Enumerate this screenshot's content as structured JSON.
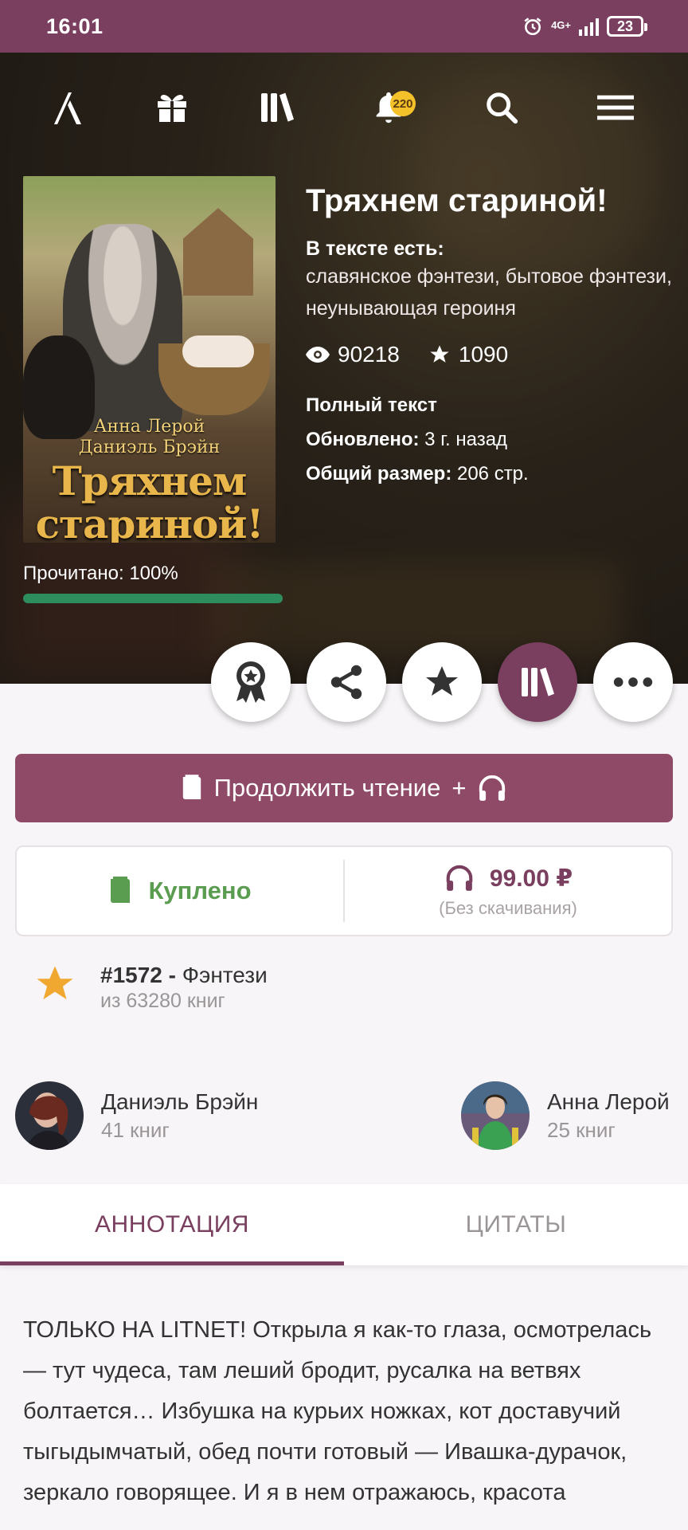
{
  "status_bar": {
    "time": "16:01",
    "network": "4G+",
    "battery": "23"
  },
  "nav": {
    "notifications_count": "220"
  },
  "book": {
    "title": "Тряхнем стариной!",
    "tags_heading": "В тексте есть:",
    "tags": "славянское фэнтези, бытовое фэнтези, неунывающая героиня",
    "views": "90218",
    "stars": "1090",
    "status": "Полный текст",
    "updated_label": "Обновлено:",
    "updated_value": " 3 г. назад",
    "size_label": "Общий размер:",
    "size_value": " 206 стр.",
    "cover_authors_line1": "Анна Лерой",
    "cover_authors_line2": "Даниэль Брэйн",
    "cover_title_line1": "Тряхнем",
    "cover_title_line2": "стариной!"
  },
  "progress": {
    "label": "Прочитано: 100%",
    "value": 1.0
  },
  "continue_button": {
    "label": "Продолжить чтение",
    "plus": "+"
  },
  "purchase": {
    "bought_label": "Куплено",
    "price": "99.00 ₽",
    "price_note": "(Без скачивания)"
  },
  "rating": {
    "rank": "#1572 -",
    "genre": " Фэнтези",
    "total": "из 63280 книг"
  },
  "authors": [
    {
      "name": "Даниэль Брэйн",
      "books": "41 книг"
    },
    {
      "name": "Анна Лерой",
      "books": "25 книг"
    }
  ],
  "tabs": [
    {
      "label": "АННОТАЦИЯ",
      "active": true
    },
    {
      "label": "ЦИТАТЫ",
      "active": false
    }
  ],
  "annotation": "ТОЛЬКО НА LITNET! Открыла я как-то глаза, осмотрелась — тут чудеса, там леший бродит, русалка на ветвях болтается… Избушка на курьих ножках, кот доставучий тыгыдымчатый, обед почти готовый — Ивашка-дурачок, зеркало говорящее. И я в нем отражаюсь, красота",
  "colors": {
    "brand": "#7a3f5f",
    "button": "#8f4a68",
    "bought_green": "#5a9c50",
    "progress_green": "#2e8d5c",
    "star_orange": "#f0a830"
  }
}
